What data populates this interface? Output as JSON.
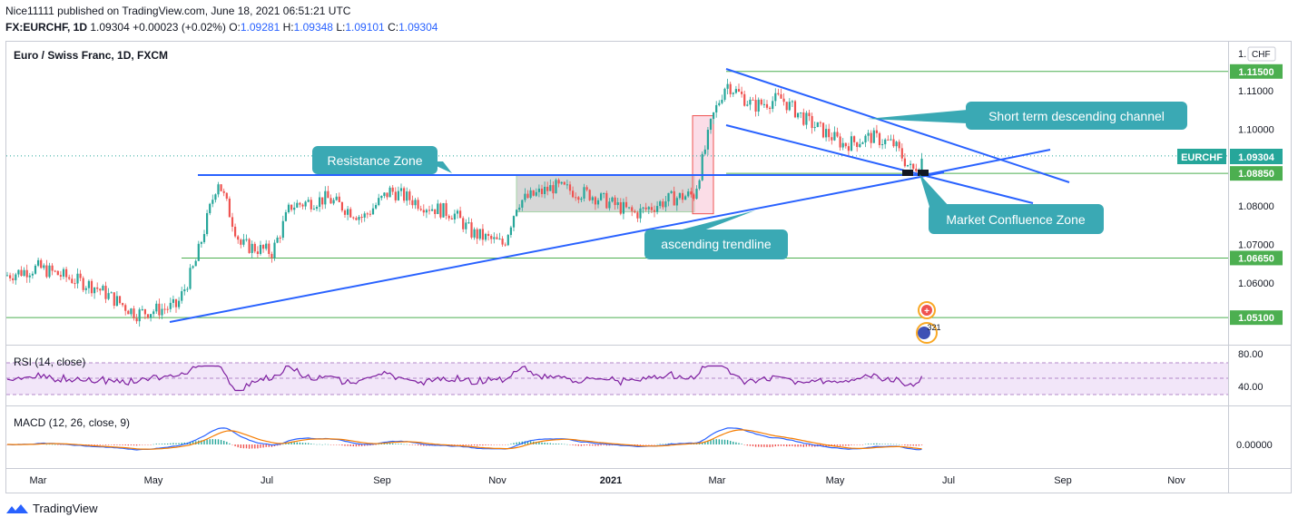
{
  "header": {
    "line1": "Nice11111 published on TradingView.com, June 18, 2021 06:51:21 UTC",
    "symbol": "FX:EURCHF, 1D",
    "last": "1.09304",
    "change": "+0.00023 (+0.02%)",
    "o_label": "O:",
    "o": "1.09281",
    "h_label": "H:",
    "h": "1.09348",
    "l_label": "L:",
    "l": "1.09101",
    "c_label": "C:",
    "c": "1.09304"
  },
  "chart_data": {
    "type": "candlestick",
    "title": "Euro / Swiss Franc, 1D, FXCM",
    "currency": "CHF",
    "y_axis_ticks": [
      "1.11000",
      "1.10000",
      "1.08000",
      "1.07000",
      "1.06000"
    ],
    "top_tick_partial": "1.",
    "x_axis_ticks": [
      "Mar",
      "May",
      "Jul",
      "Sep",
      "Nov",
      "2021",
      "Mar",
      "May",
      "Jul",
      "Sep",
      "Nov"
    ],
    "horizontal_levels": [
      {
        "label": "1.11500",
        "value": 1.115
      },
      {
        "label": "1.08850",
        "value": 1.0885
      },
      {
        "label": "1.06650",
        "value": 1.0665
      },
      {
        "label": "1.05100",
        "value": 1.051
      }
    ],
    "last_price": {
      "symbol": "EURCHF",
      "label": "1.09304",
      "value": 1.09304
    },
    "annotations": [
      "Resistance Zone",
      "ascending trendline",
      "Short term descending channel",
      "Market Confluence Zone"
    ],
    "event_badge": "321",
    "series_approx": [
      {
        "date": "2020-03",
        "close": 1.062
      },
      {
        "date": "2020-05",
        "close": 1.052
      },
      {
        "date": "2020-06",
        "close": 1.087
      },
      {
        "date": "2020-07",
        "close": 1.068
      },
      {
        "date": "2020-09",
        "close": 1.081
      },
      {
        "date": "2020-10",
        "close": 1.072
      },
      {
        "date": "2020-11",
        "close": 1.081
      },
      {
        "date": "2020-12",
        "close": 1.084
      },
      {
        "date": "2021-01",
        "close": 1.079
      },
      {
        "date": "2021-02",
        "close": 1.094
      },
      {
        "date": "2021-03",
        "close": 1.108
      },
      {
        "date": "2021-04",
        "close": 1.104
      },
      {
        "date": "2021-05",
        "close": 1.097
      },
      {
        "date": "2021-06",
        "close": 1.093
      }
    ]
  },
  "rsi": {
    "title": "RSI (14, close)",
    "ticks": [
      "80.00",
      "40.00"
    ],
    "colors": {
      "line": "#7e1fa0",
      "band": "#e9d5f5"
    }
  },
  "macd": {
    "title": "MACD (12, 26, close, 9)",
    "tick": "0.00000",
    "colors": {
      "macd": "#2962ff",
      "signal": "#f57c00",
      "hist_up": "#26a69a",
      "hist_down": "#ef5350"
    }
  },
  "colors": {
    "up": "#26a69a",
    "down": "#ef5350",
    "trend": "#2962ff",
    "level": "#4caf50",
    "callout": "#3aa9b4"
  },
  "footer": {
    "brand": "TradingView"
  }
}
